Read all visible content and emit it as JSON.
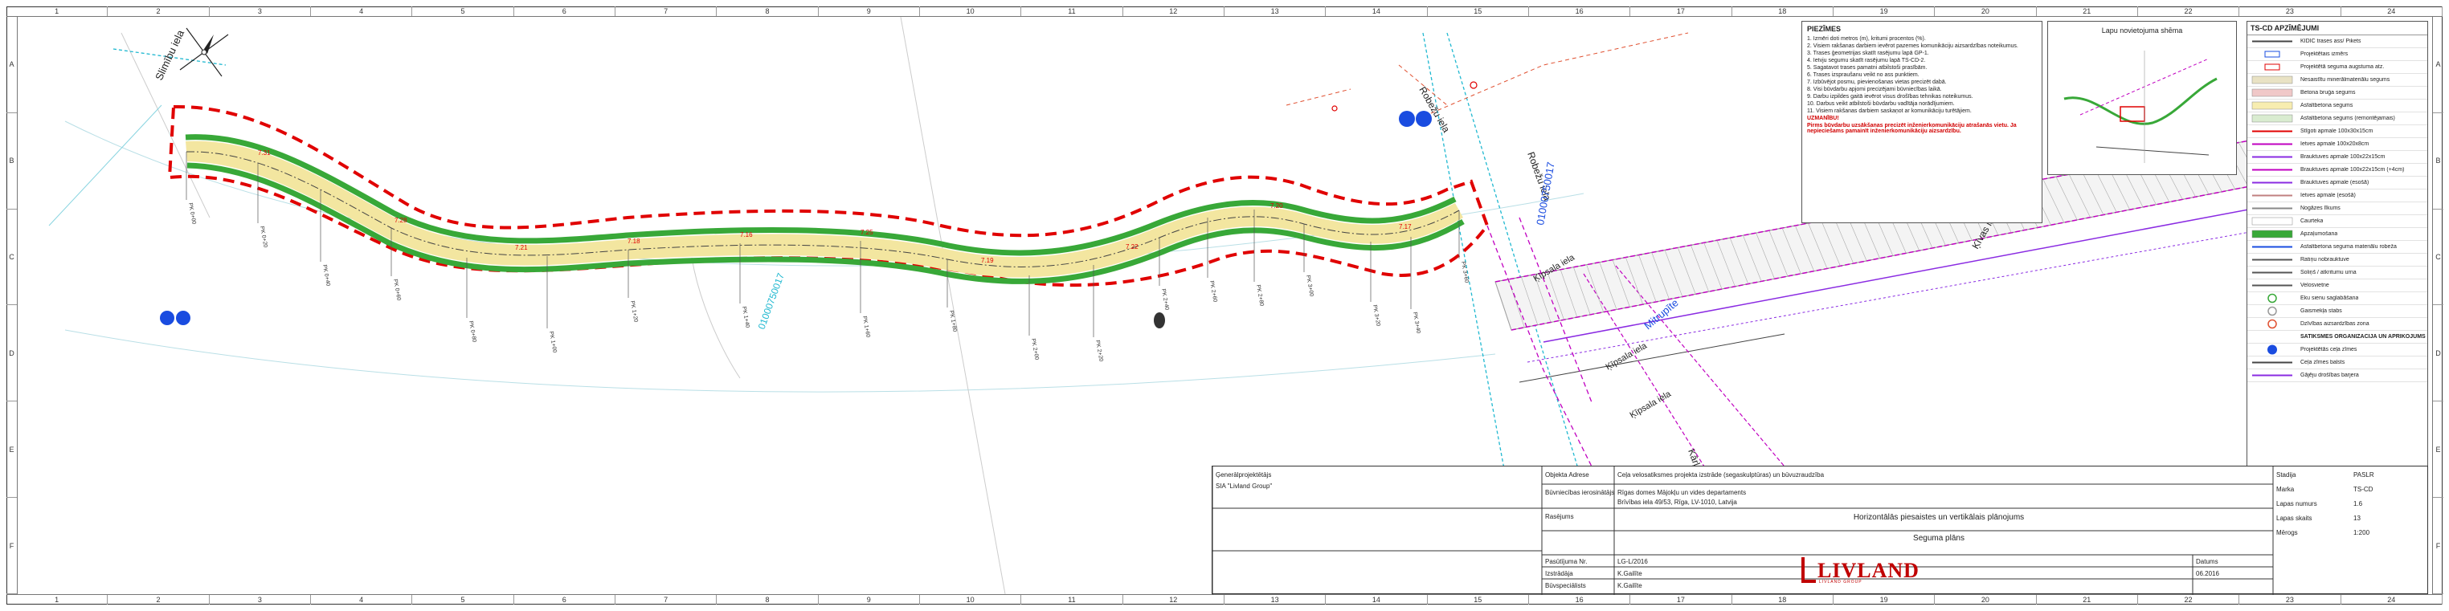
{
  "sheet": {
    "grid_columns": [
      "1",
      "2",
      "3",
      "4",
      "5",
      "6",
      "7",
      "8",
      "9",
      "10",
      "11",
      "12",
      "13",
      "14",
      "15",
      "16",
      "17",
      "18",
      "19",
      "20",
      "21",
      "22",
      "23",
      "24"
    ],
    "grid_rows": [
      "A",
      "B",
      "C",
      "D",
      "E",
      "F"
    ]
  },
  "map": {
    "street_labels": [
      {
        "text": "Slimību iela"
      },
      {
        "text": "Robežu iela"
      },
      {
        "text": "Robežu iela"
      },
      {
        "text": "Ķīpsala iela"
      },
      {
        "text": "Ķīpsala iela"
      },
      {
        "text": "Ķīpsala iela"
      },
      {
        "text": "Mitrupīte"
      },
      {
        "text": "Ķīvas iela"
      },
      {
        "text": "Ķīvas iela"
      },
      {
        "text": "Kārļa Ulmaņa gatve"
      }
    ],
    "parcel_codes": [
      {
        "text": "01000750017"
      },
      {
        "text": "01000750017"
      },
      {
        "text": "01000883033"
      }
    ],
    "elevation_marks": [
      "7.31",
      "7.28",
      "7.21",
      "7.18",
      "7.16",
      "7.25",
      "7.19",
      "7.22",
      "7.20",
      "7.17"
    ],
    "station_labels": [
      "PK 0+00",
      "PK 0+20",
      "PK 0+40",
      "PK 0+60",
      "PK 0+80",
      "PK 1+00",
      "PK 1+20",
      "PK 1+40",
      "PK 1+60",
      "PK 1+80",
      "PK 2+00",
      "PK 2+20",
      "PK 2+40",
      "PK 2+60",
      "PK 2+80",
      "PK 3+00",
      "PK 3+20",
      "PK 3+40",
      "PK 3+60"
    ],
    "colors": {
      "border_red": "#e00000",
      "road_green": "#38a838",
      "road_fill": "#f3e6a0",
      "magenta": "#c000c0",
      "cyan": "#20b8d0",
      "blue_parcel": "#1a4ce0",
      "purple_boundary": "#8a2be2"
    }
  },
  "notes": {
    "title": "PIEZĪMES",
    "items": [
      "1. Izmēri doti metros (m), kritumi procentos (%).",
      "2. Visiem rakšanas darbiem ievērot pazemes komunikāciju aizsardzības noteikumus.",
      "3. Trases ģeometrijas skatīt rasējumu lapā GP-1.",
      "4. Ietvju segumu skatīt rasējumu lapā TS-CD-2.",
      "5. Sagatavot trases pamatni atbilstoši prasībām.",
      "6. Trases izspraušanu veikt no ass punktiem.",
      "7. Izbūvējot posmu, pievienošanas vietas precizēt dabā.",
      "8. Visi būvdarbu apjomi precizējami būvniecības laikā.",
      "9. Darbu izpildes gaitā ievērot visus drošības tehnikas noteikumus.",
      "10. Darbus veikt atbilstoši būvdarbu vadītāja norādījumiem.",
      "11. Visiem rakšanas darbiem saskaņot ar komunikāciju turētājiem."
    ],
    "warning_title": "UZMANĪBU!",
    "warning_text": "Pirms būvdarbu uzsākšanas precizēt inženierkomunikāciju atrašanās vietu. Ja nepieciešams pamainīt inženierkomunikāciju aizsardzību."
  },
  "scheme": {
    "title": "Lapu novietojuma shēma"
  },
  "legend": {
    "title": "TS-CD APZĪMĒJUMI",
    "items": [
      {
        "label": "KIDIC trases ass/ Pikets",
        "kind": "line",
        "color": "#444444"
      },
      {
        "label": "Projektētais izmērs",
        "kind": "text",
        "color": "#1a4ce0"
      },
      {
        "label": "Projektētā seguma augstuma atz.",
        "kind": "text",
        "color": "#e00000"
      },
      {
        "label": "Nesaistītu minerālmateriālu segums",
        "kind": "fill",
        "color": "#e9e2c4"
      },
      {
        "label": "Betona bruģa segums",
        "kind": "fill",
        "color": "#f0c8c8"
      },
      {
        "label": "Asfaltbetona segums",
        "kind": "fill",
        "color": "#f7edb0"
      },
      {
        "label": "Asfaltbetona segums (remontējamais)",
        "kind": "fill",
        "color": "#d9ecd0"
      },
      {
        "label": "Stīgoti apmale 100x30x15cm",
        "kind": "line",
        "color": "#e00000"
      },
      {
        "label": "Ietves apmale 100x20x8cm",
        "kind": "line",
        "color": "#c000c0"
      },
      {
        "label": "Brauktuves apmale 100x22x15cm",
        "kind": "line",
        "color": "#8a2be2"
      },
      {
        "label": "Brauktuves apmale 100x22x15cm (+4cm)",
        "kind": "line",
        "color": "#c000c0"
      },
      {
        "label": "Brauktuves apmale (esošā)",
        "kind": "line",
        "color": "#8a2be2"
      },
      {
        "label": "Ietves apmale (esošā)",
        "kind": "line",
        "color": "#c08080"
      },
      {
        "label": "Nogāzes līkums",
        "kind": "line",
        "color": "#888888"
      },
      {
        "label": "Caurteka",
        "kind": "fill",
        "color": "#ffffff"
      },
      {
        "label": "Apzaļumošana",
        "kind": "fill",
        "color": "#38a838"
      },
      {
        "label": "Asfaltbetona seguma materiālu robeža",
        "kind": "line",
        "color": "#1a4ce0"
      },
      {
        "label": "Ratiņu nobrauktuve",
        "kind": "line",
        "color": "#555555"
      },
      {
        "label": "Soliņš / atkritumu urna",
        "kind": "line",
        "color": "#555555"
      },
      {
        "label": "Velosvietne",
        "kind": "line",
        "color": "#555555"
      },
      {
        "label": "Ēku sienu saglabāšana",
        "kind": "circle",
        "color": "#38a838"
      },
      {
        "label": "Gaismekļa stabs",
        "kind": "circle",
        "color": "#999999"
      },
      {
        "label": "Dzīvības aizsardzības zona",
        "kind": "circle",
        "color": "#e05030"
      },
      {
        "label": "SATIKSMES ORGANIZĀCIJA UN APRĪKOJUMS",
        "kind": "header",
        "color": "#222222"
      },
      {
        "label": "Projektētās ceļa zīmes",
        "kind": "sign",
        "color": "#1a4ce0"
      },
      {
        "label": "Ceļa zīmes balsts",
        "kind": "line",
        "color": "#444444"
      },
      {
        "label": "Gājēju drošības barjera",
        "kind": "line",
        "color": "#8a2be2"
      }
    ]
  },
  "title_block": {
    "designer_label": "Ģenerālprojektētājs",
    "designer_text": "SIA \"Livland Group\"",
    "object_label": "Objekta Adrese",
    "object_text": "Ceļa velosatiksmes projekta izstrāde (segaskulptūras) un būvuzraudzība",
    "client_label": "Būvniecības ierosinātājs",
    "client_text": "Rīgas domes Mājokļu un vides departaments",
    "client_address": "Brīvības iela 49/53, Rīga, LV-1010, Latvija",
    "section_label": "Rasējums",
    "drawing_title": "Horizontālās piesaistes un vertikālais plānojums",
    "drawing_subtitle": "Seguma plāns",
    "project_no_label": "Pasūtījuma Nr.",
    "project_no": "LG-L/2016",
    "stage_label": "Stadija",
    "stage": "PASLR",
    "mark_label": "Marka",
    "mark": "TS-CD",
    "sheet_label": "Lapas numurs",
    "sheet_no": "1.6",
    "sheets_label": "Lapas skaits",
    "sheets": "13",
    "scale_label": "Mērogs",
    "scale": "1:200",
    "date_label": "Datums",
    "date": "06.2016",
    "author_label": "Izstrādāja",
    "author": "K.Gailīte",
    "checked_label": "Būvspeciālists",
    "checked": "K.Gailīte"
  },
  "logo": {
    "word": "LIVLAND",
    "tagline": "LIVLAND GROUP"
  }
}
